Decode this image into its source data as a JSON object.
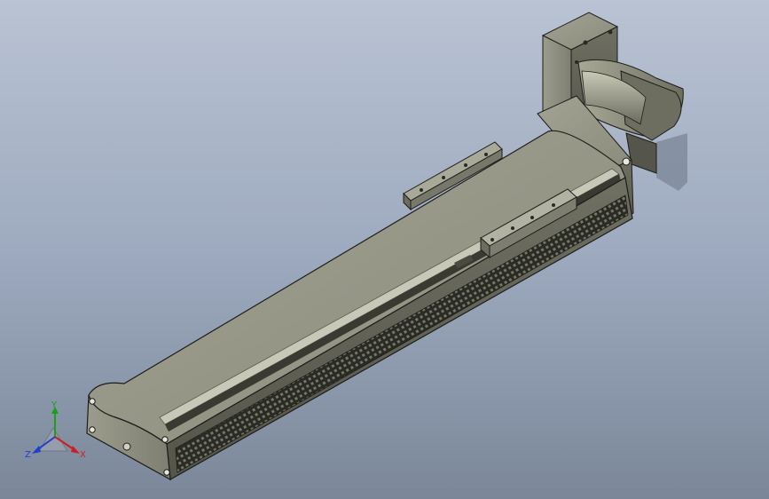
{
  "viewport": {
    "background_top": "#b9c3d3",
    "background_bottom": "#7b8799"
  },
  "model": {
    "body_color": "#8f8f80",
    "dark_edge_color": "#1d1d1a",
    "highlight_color": "#c8c8b8"
  },
  "triad": {
    "x_label": "X",
    "y_label": "Y",
    "z_label": "Z",
    "x_color": "#cc1f1f",
    "y_color": "#1a9f1a",
    "z_color": "#1f3fcc"
  }
}
